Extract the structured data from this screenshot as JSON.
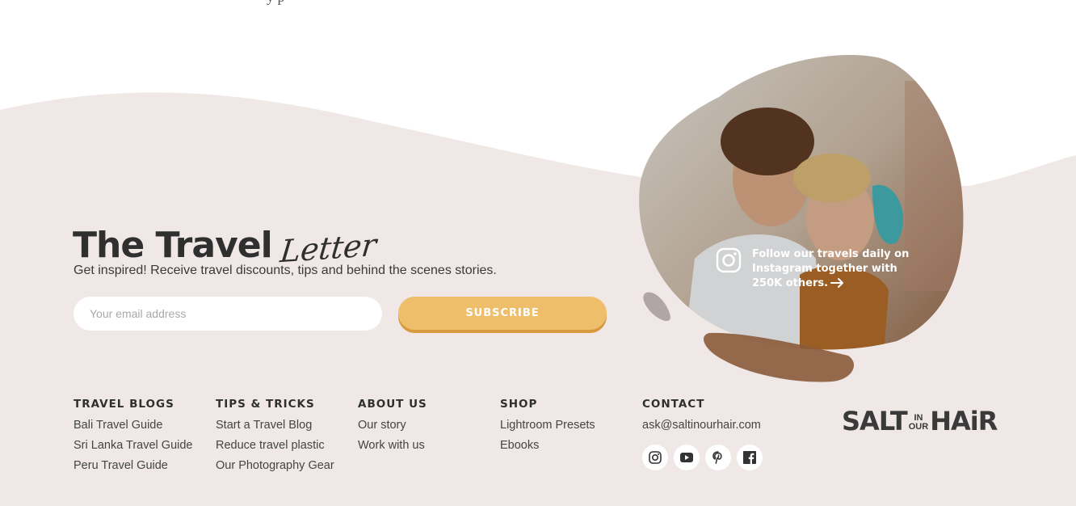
{
  "newsletter": {
    "title_main": "The Travel",
    "title_script": "Letter",
    "subtitle": "Get inspired! Receive travel discounts, tips and behind the scenes stories.",
    "email_placeholder": "Your email address",
    "subscribe_label": "SUBSCRIBE"
  },
  "instagram": {
    "text": "Follow our travels daily on Instagram together with 250K others."
  },
  "footer": {
    "columns": [
      {
        "heading": "TRAVEL BLOGS",
        "links": [
          "Bali Travel Guide",
          "Sri Lanka Travel Guide",
          "Peru Travel Guide"
        ]
      },
      {
        "heading": "TIPS & TRICKS",
        "links": [
          "Start a Travel Blog",
          "Reduce travel plastic",
          "Our Photography Gear"
        ]
      },
      {
        "heading": "ABOUT US",
        "links": [
          "Our story",
          "Work with us"
        ]
      },
      {
        "heading": "SHOP",
        "links": [
          "Lightroom Presets",
          "Ebooks"
        ]
      },
      {
        "heading": "CONTACT",
        "links": [
          "ask@saltinourhair.com"
        ]
      }
    ],
    "social_icons": [
      "instagram-icon",
      "youtube-icon",
      "pinterest-icon",
      "facebook-icon"
    ]
  },
  "logo": {
    "left": "SALT",
    "small_top": "IN",
    "small_bottom": "OUR",
    "right": "HAiR"
  },
  "colors": {
    "background": "#efe8e6",
    "accent": "#efbe6b",
    "text": "#2f2f2f"
  }
}
